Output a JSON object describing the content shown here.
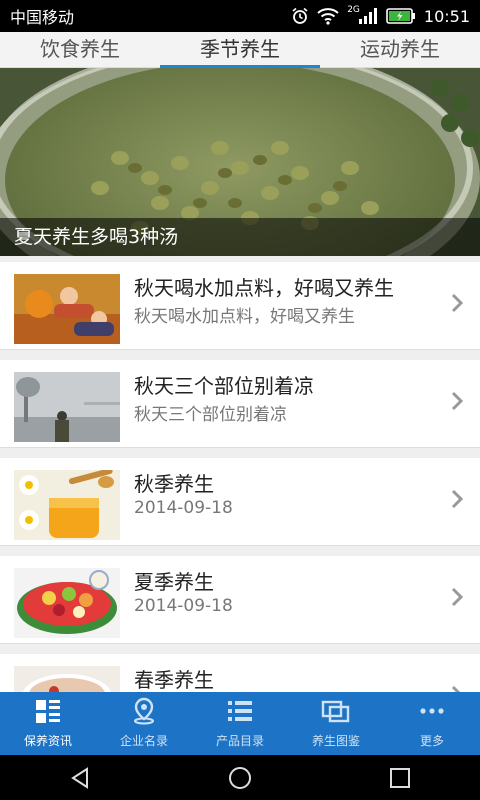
{
  "status_bar": {
    "carrier": "中国移动",
    "network": "2G",
    "time": "10:51"
  },
  "tabs": [
    {
      "label": "饮食养生",
      "active": false
    },
    {
      "label": "季节养生",
      "active": true
    },
    {
      "label": "运动养生",
      "active": false
    }
  ],
  "banner": {
    "caption": "夏天养生多喝3种汤",
    "image": "mung-bean-soup-photo"
  },
  "list": [
    {
      "title": "秋天喝水加点料，好喝又养生",
      "subtitle": "秋天喝水加点料，好喝又养生",
      "image": "couple-autumn-leaves-photo"
    },
    {
      "title": "秋天三个部位别着凉",
      "subtitle": "秋天三个部位别着凉",
      "image": "foggy-park-photo"
    },
    {
      "title": "秋季养生",
      "subtitle": "2014-09-18",
      "image": "honey-jar-photo"
    },
    {
      "title": "夏季养生",
      "subtitle": "2014-09-18",
      "image": "fruit-bowl-photo"
    },
    {
      "title": "春季养生",
      "subtitle": "",
      "image": "soup-bowl-photo"
    }
  ],
  "bottom_nav": [
    {
      "label": "保养资讯",
      "icon": "news-icon",
      "active": true
    },
    {
      "label": "企业名录",
      "icon": "location-icon",
      "active": false
    },
    {
      "label": "产品目录",
      "icon": "list-icon",
      "active": false
    },
    {
      "label": "养生图鉴",
      "icon": "gallery-icon",
      "active": false
    },
    {
      "label": "更多",
      "icon": "more-icon",
      "active": false
    }
  ],
  "colors": {
    "accent": "#1e86d6",
    "bottom_nav_bg": "#1d74c6"
  }
}
